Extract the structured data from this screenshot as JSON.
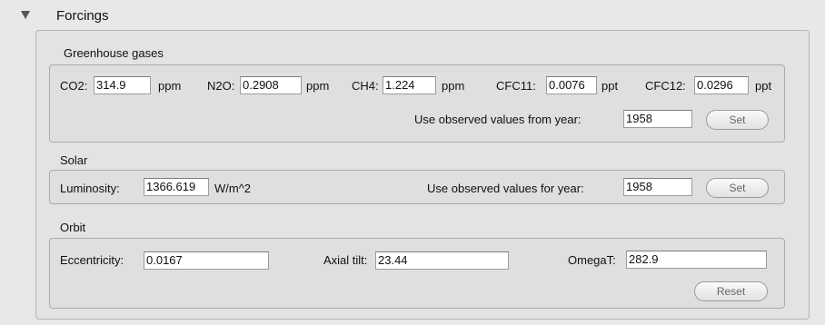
{
  "panel": {
    "title": "Forcings",
    "ghg": {
      "title": "Greenhouse gases",
      "co2": {
        "label": "CO2:",
        "value": "314.9",
        "unit": "ppm"
      },
      "n2o": {
        "label": "N2O:",
        "value": "0.2908",
        "unit": "ppm"
      },
      "ch4": {
        "label": "CH4:",
        "value": "1.224",
        "unit": "ppm"
      },
      "cfc11": {
        "label": "CFC11:",
        "value": "0.0076",
        "unit": "ppt"
      },
      "cfc12": {
        "label": "CFC12:",
        "value": "0.0296",
        "unit": "ppt"
      },
      "observed_label": "Use observed values from year:",
      "year": "1958",
      "set_label": "Set"
    },
    "solar": {
      "title": "Solar",
      "luminosity_label": "Luminosity:",
      "luminosity_value": "1366.619",
      "luminosity_unit": "W/m^2",
      "observed_label": "Use observed values for year:",
      "year": "1958",
      "set_label": "Set"
    },
    "orbit": {
      "title": "Orbit",
      "eccentricity_label": "Eccentricity:",
      "eccentricity_value": "0.0167",
      "axial_tilt_label": "Axial tilt:",
      "axial_tilt_value": "23.44",
      "omegat_label": "OmegaT:",
      "omegat_value": "282.9",
      "reset_label": "Reset"
    }
  },
  "icons": {
    "disclosure": "disclosure-triangle-icon"
  },
  "colors": {
    "background": "#e8e8e8",
    "field": "#ffffff",
    "border": "#ababab"
  }
}
